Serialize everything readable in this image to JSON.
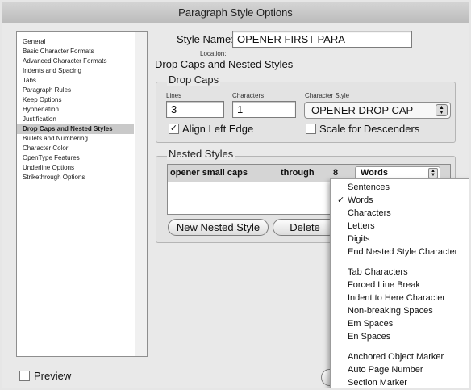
{
  "window": {
    "title": "Paragraph Style Options"
  },
  "sidebar": {
    "items": [
      {
        "label": "General"
      },
      {
        "label": "Basic Character Formats"
      },
      {
        "label": "Advanced Character Formats"
      },
      {
        "label": "Indents and Spacing"
      },
      {
        "label": "Tabs"
      },
      {
        "label": "Paragraph Rules"
      },
      {
        "label": "Keep Options"
      },
      {
        "label": "Hyphenation"
      },
      {
        "label": "Justification"
      },
      {
        "label": "Drop Caps and Nested Styles",
        "selected": true
      },
      {
        "label": "Bullets and Numbering"
      },
      {
        "label": "Character Color"
      },
      {
        "label": "OpenType Features"
      },
      {
        "label": "Underline Options"
      },
      {
        "label": "Strikethrough Options"
      }
    ]
  },
  "header": {
    "style_name_label": "Style Name:",
    "style_name_value": "OPENER FIRST PARA",
    "location_label": "Location:",
    "section_title": "Drop Caps and Nested Styles"
  },
  "drop_caps": {
    "title": "Drop Caps",
    "lines_label": "Lines",
    "lines_value": "3",
    "characters_label": "Characters",
    "characters_value": "1",
    "char_style_label": "Character Style",
    "char_style_value": "OPENER DROP CAP",
    "align_left_label": "Align Left Edge",
    "align_left_checked": true,
    "scale_desc_label": "Scale for Descenders",
    "scale_desc_checked": false
  },
  "nested_styles": {
    "title": "Nested Styles",
    "row": {
      "style": "opener small caps",
      "mode": "through",
      "count": "8",
      "unit": "Words"
    },
    "new_button": "New Nested Style",
    "delete_button": "Delete"
  },
  "dropdown_menu": {
    "items": [
      {
        "label": "Sentences",
        "checked": false
      },
      {
        "label": "Words",
        "checked": true
      },
      {
        "label": "Characters",
        "checked": false
      },
      {
        "label": "Letters",
        "checked": false
      },
      {
        "label": "Digits",
        "checked": false
      },
      {
        "label": "End Nested Style Character",
        "checked": false
      },
      {
        "label": "Tab Characters",
        "checked": false
      },
      {
        "label": "Forced Line Break",
        "checked": false
      },
      {
        "label": "Indent to Here Character",
        "checked": false
      },
      {
        "label": "Non-breaking Spaces",
        "checked": false
      },
      {
        "label": "Em Spaces",
        "checked": false
      },
      {
        "label": "En Spaces",
        "checked": false
      },
      {
        "label": "Anchored Object Marker",
        "checked": false
      },
      {
        "label": "Auto Page Number",
        "checked": false
      },
      {
        "label": "Section Marker",
        "checked": false
      }
    ],
    "check_glyph": "✓"
  },
  "footer": {
    "preview_label": "Preview",
    "preview_checked": false
  }
}
